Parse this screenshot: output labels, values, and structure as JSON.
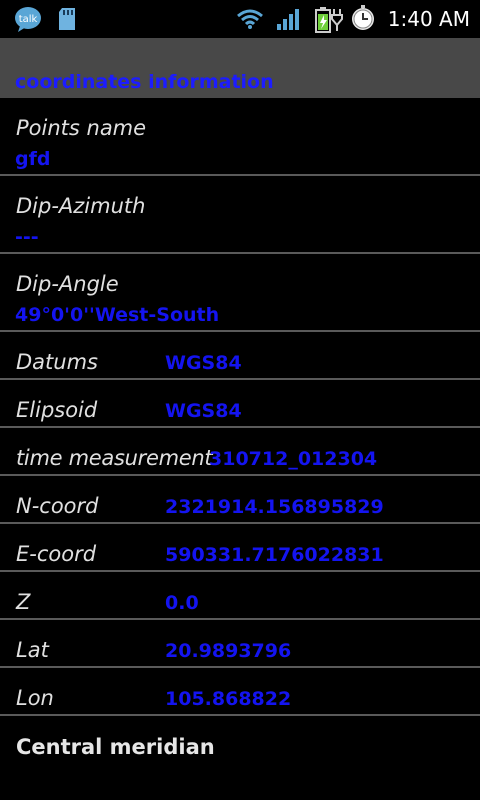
{
  "status_bar": {
    "time": "1:40 AM",
    "talk_icon_label": "talk",
    "icons": [
      "talk-icon",
      "sd-card-icon",
      "wifi-icon",
      "signal-icon",
      "battery-charging-icon",
      "alarm-clock-icon"
    ]
  },
  "header": {
    "title": "coordinates information"
  },
  "fields": {
    "points_name": {
      "label": "Points name",
      "value": "gfd"
    },
    "dip_azimuth": {
      "label": "Dip-Azimuth",
      "value": "---"
    },
    "dip_angle": {
      "label": "Dip-Angle",
      "value": "49°0'0''West-South"
    },
    "datums": {
      "label": "Datums",
      "value": "WGS84"
    },
    "elipsoid": {
      "label": "Elipsoid",
      "value": "WGS84"
    },
    "time_measurement": {
      "label": "time measurement",
      "value": "310712_012304"
    },
    "n_coord": {
      "label": "N-coord",
      "value": "2321914.156895829"
    },
    "e_coord": {
      "label": "E-coord",
      "value": "590331.7176022831"
    },
    "z": {
      "label": "Z",
      "value": "0.0"
    },
    "lat": {
      "label": "Lat",
      "value": "20.9893796"
    },
    "lon": {
      "label": "Lon",
      "value": "105.868822"
    }
  },
  "central_meridian": {
    "title": "Central meridian"
  },
  "colors": {
    "value": "#1414f0",
    "header_bg": "#484848",
    "divider": "#5a5a5a"
  }
}
